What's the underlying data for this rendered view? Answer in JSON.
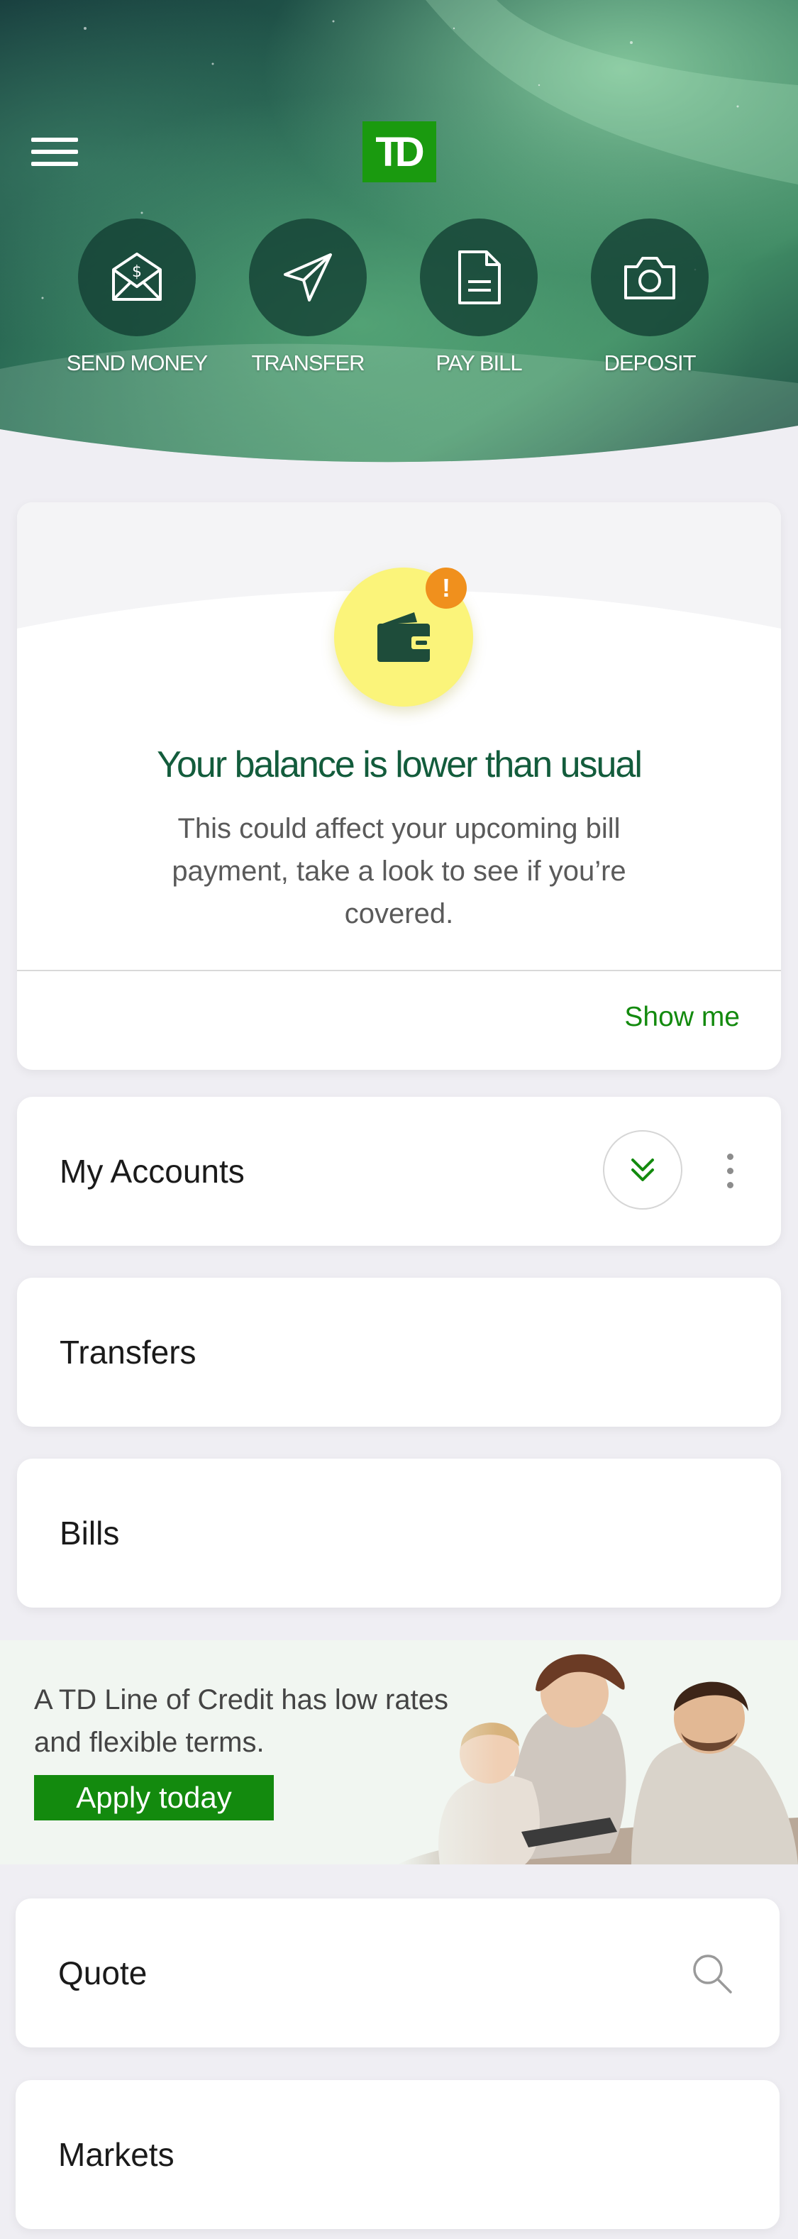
{
  "brand": {
    "logo_text": "TD"
  },
  "quick_actions": [
    {
      "label": "SEND MONEY",
      "icon": "envelope-dollar-icon"
    },
    {
      "label": "TRANSFER",
      "icon": "paper-plane-icon"
    },
    {
      "label": "PAY BILL",
      "icon": "document-icon"
    },
    {
      "label": "DEPOSIT",
      "icon": "camera-icon"
    }
  ],
  "alert": {
    "badge": "!",
    "title": "Your balance is lower than usual",
    "body": "This could affect your upcoming bill payment, take a look to see if you’re covered.",
    "action": "Show me"
  },
  "sections": {
    "accounts": "My Accounts",
    "transfers": "Transfers",
    "bills": "Bills",
    "quote": "Quote",
    "markets": "Markets"
  },
  "promo": {
    "text": "A TD Line of Credit has low rates and flexible terms.",
    "button": "Apply today"
  },
  "colors": {
    "brand_green": "#1a9a0f",
    "link_green": "#138a0e",
    "title_green": "#135c3c",
    "warning_orange": "#f0901d",
    "wallet_yellow": "#fbf47a",
    "page_background": "#efeef3"
  }
}
